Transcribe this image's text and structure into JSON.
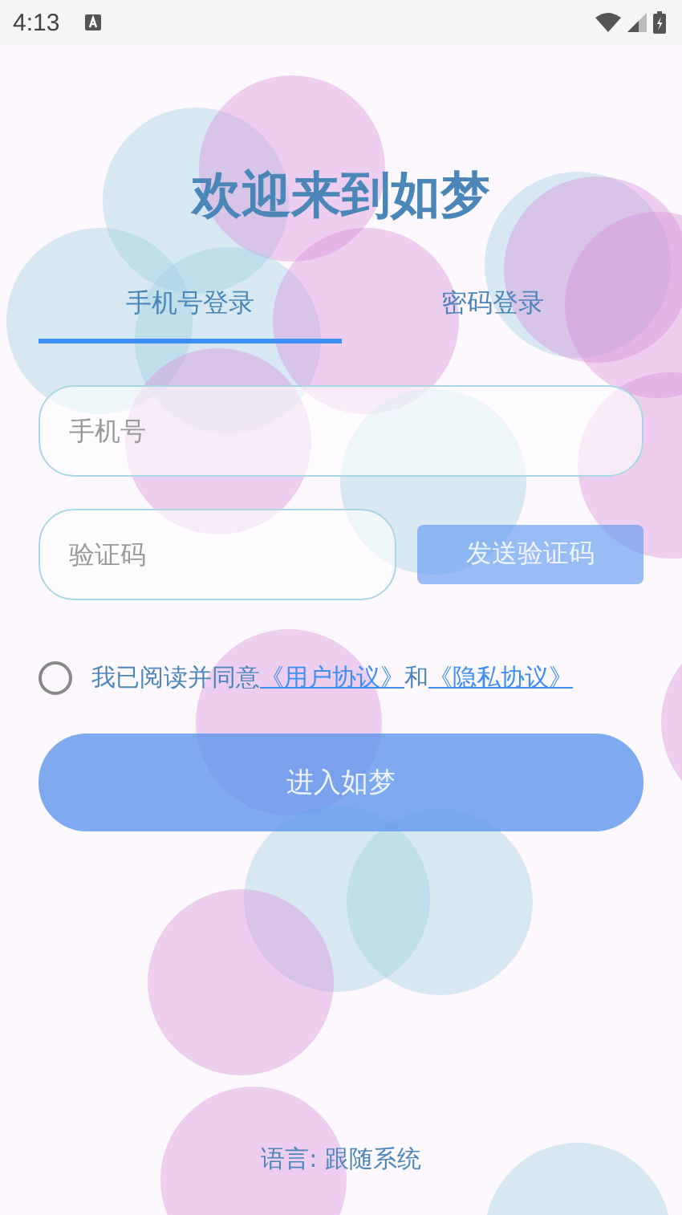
{
  "status_bar": {
    "time": "4:13"
  },
  "title": "欢迎来到如梦",
  "tabs": [
    {
      "label": "手机号登录",
      "selected": true
    },
    {
      "label": "密码登录",
      "selected": false
    }
  ],
  "phone_field": {
    "placeholder": "手机号"
  },
  "code_field": {
    "placeholder": "验证码"
  },
  "send_code_button": {
    "label": "发送验证码",
    "disabled": true
  },
  "agreement": {
    "checked": false,
    "text": "我已阅读并同意",
    "link_1": "《用户协议》",
    "joiner": "和",
    "link_2": "《隐私协议》"
  },
  "enter_button": {
    "label": "进入如梦",
    "disabled": true
  },
  "language": "语言: 跟随系统"
}
